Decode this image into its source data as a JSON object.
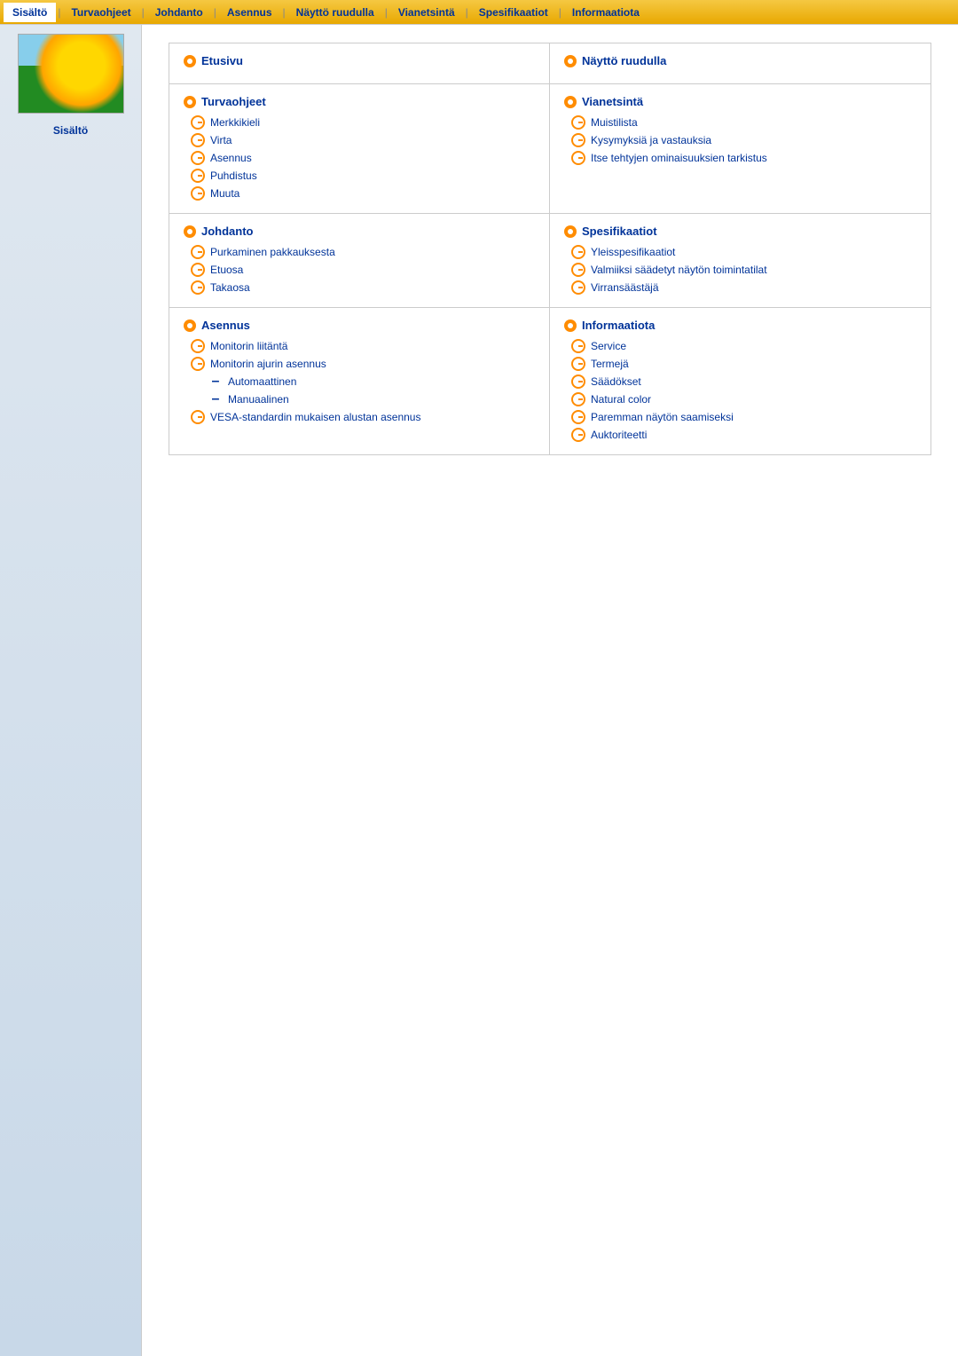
{
  "nav": {
    "items": [
      {
        "id": "sisalto",
        "label": "Sisältö",
        "active": true
      },
      {
        "id": "turvaohjeet",
        "label": "Turvaohjeet",
        "active": false
      },
      {
        "id": "johdanto",
        "label": "Johdanto",
        "active": false
      },
      {
        "id": "asennus",
        "label": "Asennus",
        "active": false
      },
      {
        "id": "naytto",
        "label": "Näyttö ruudulla",
        "active": false
      },
      {
        "id": "vianetsinta",
        "label": "Vianetsintä",
        "active": false
      },
      {
        "id": "spesifikaatiot",
        "label": "Spesifikaatiot",
        "active": false
      },
      {
        "id": "informaatiota",
        "label": "Informaatiota",
        "active": false
      }
    ]
  },
  "sidebar": {
    "label": "Sisältö"
  },
  "sections": [
    {
      "id": "etusivu",
      "type": "top-level-link",
      "title": "Etusivu",
      "icon": "orange-circle",
      "items": []
    },
    {
      "id": "naytto-ruudulla",
      "type": "top-level-link",
      "title": "Näyttö ruudulla",
      "icon": "orange-circle",
      "items": []
    },
    {
      "id": "turvaohjeet",
      "type": "section",
      "title": "Turvaohjeet",
      "icon": "orange-circle",
      "items": [
        {
          "label": "Merkkikieli",
          "icon": "g",
          "indent": false
        },
        {
          "label": "Virta",
          "icon": "g",
          "indent": false
        },
        {
          "label": "Asennus",
          "icon": "g",
          "indent": false
        },
        {
          "label": "Puhdistus",
          "icon": "g",
          "indent": false
        },
        {
          "label": "Muuta",
          "icon": "g",
          "indent": false
        }
      ]
    },
    {
      "id": "vianetsinta",
      "type": "section",
      "title": "Vianetsintä",
      "icon": "orange-circle",
      "items": [
        {
          "label": "Muistilista",
          "icon": "g",
          "indent": false
        },
        {
          "label": "Kysymyksiä ja vastauksia",
          "icon": "g",
          "indent": false
        },
        {
          "label": "Itse tehtyjen ominaisuuksien tarkistus",
          "icon": "g",
          "indent": false
        }
      ]
    },
    {
      "id": "johdanto",
      "type": "section",
      "title": "Johdanto",
      "icon": "orange-circle",
      "items": [
        {
          "label": "Purkaminen pakkauksesta",
          "icon": "g",
          "indent": false
        },
        {
          "label": "Etuosa",
          "icon": "g",
          "indent": false
        },
        {
          "label": "Takaosa",
          "icon": "g",
          "indent": false
        }
      ]
    },
    {
      "id": "spesifikaatiot",
      "type": "section",
      "title": "Spesifikaatiot",
      "icon": "orange-circle",
      "items": [
        {
          "label": "Yleisspesifikaatiot",
          "icon": "g",
          "indent": false
        },
        {
          "label": "Valmiiksi säädetyt näytön toimintatilat",
          "icon": "g",
          "indent": false
        },
        {
          "label": "Virransäästäjä",
          "icon": "g",
          "indent": false
        }
      ]
    },
    {
      "id": "asennus",
      "type": "section",
      "title": "Asennus",
      "icon": "orange-circle",
      "items": [
        {
          "label": "Monitorin liitäntä",
          "icon": "g",
          "indent": false
        },
        {
          "label": "Monitorin ajurin asennus",
          "icon": "g",
          "indent": false
        },
        {
          "label": "Automaattinen",
          "icon": "dash",
          "indent": true
        },
        {
          "label": "Manuaalinen",
          "icon": "dash",
          "indent": true
        },
        {
          "label": "VESA-standardin mukaisen alustan asennus",
          "icon": "g",
          "indent": false
        }
      ]
    },
    {
      "id": "informaatiota",
      "type": "section",
      "title": "Informaatiota",
      "icon": "orange-circle",
      "items": [
        {
          "label": "Service",
          "icon": "g",
          "indent": false
        },
        {
          "label": "Termejä",
          "icon": "g",
          "indent": false
        },
        {
          "label": "Säädökset",
          "icon": "g",
          "indent": false
        },
        {
          "label": "Natural color",
          "icon": "g",
          "indent": false
        },
        {
          "label": "Paremman näytön saamiseksi",
          "icon": "g",
          "indent": false
        },
        {
          "label": "Auktoriteetti",
          "icon": "g",
          "indent": false
        }
      ]
    }
  ]
}
